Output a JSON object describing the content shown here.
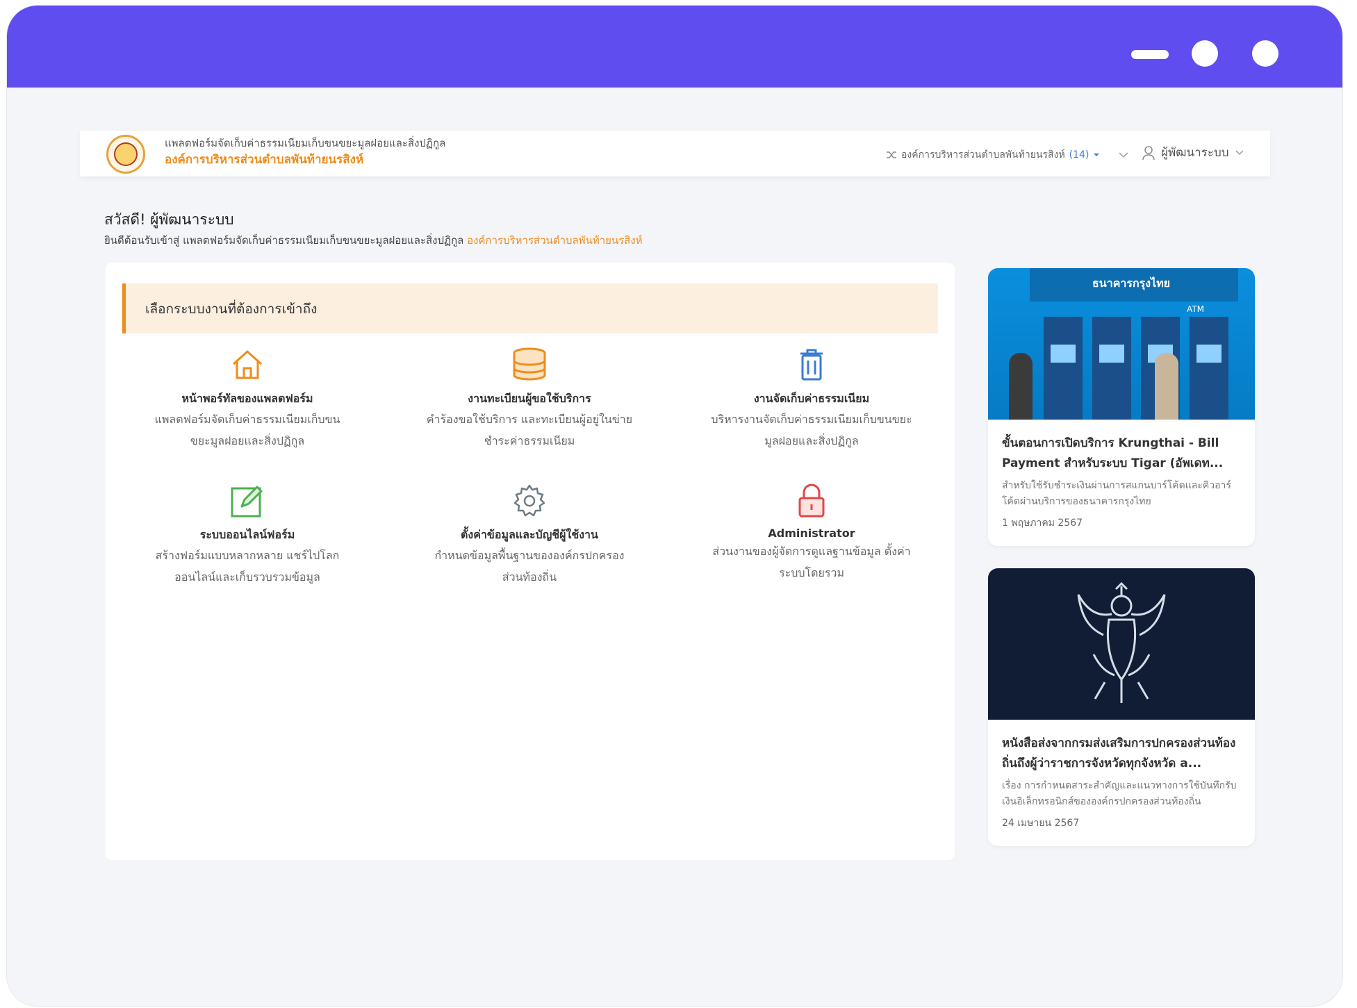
{
  "window": {
    "minimize_icon": "minimize-icon",
    "maximize_icon": "circle-icon",
    "close_icon": "circle-icon",
    "accent": "#5f4df0"
  },
  "header": {
    "brand_subtitle": "แพลตฟอร์มจัดเก็บค่าธรรมเนียมเก็บขนขยะมูลฝอยและสิ่งปฏิกูล",
    "brand_title": "องค์การบริหารส่วนตำบลพันท้ายนรสิงห์",
    "org_switch_label": "องค์การบริหารส่วนตำบลพันท้ายนรสิงห์",
    "org_switch_count": "(14)",
    "user_label": "ผู้พัฒนาระบบ"
  },
  "greeting": {
    "title": "สวัสดี! ผู้พัฒนาระบบ",
    "text": "ยินดีต้อนรับเข้าสู่ แพลตฟอร์มจัดเก็บค่าธรรมเนียมเก็บขนขยะมูลฝอยและสิ่งปฏิกูล",
    "org": "องค์การบริหารส่วนตำบลพันท้ายนรสิงห์"
  },
  "systems": {
    "heading": "เลือกระบบงานที่ต้องการเข้าถึง",
    "items": [
      {
        "icon": "home-icon",
        "title": "หน้าพอร์ทัลของแพลตฟอร์ม",
        "desc1": "แพลตฟอร์มจัดเก็บค่าธรรมเนียมเก็บขน",
        "desc2": "ขยะมูลฝอยและสิ่งปฏิกูล"
      },
      {
        "icon": "database-icon",
        "title": "งานทะเบียนผู้ขอใช้บริการ",
        "desc1": "คำร้องขอใช้บริการ และทะเบียนผู้อยู่ในข่าย",
        "desc2": "ชำระค่าธรรมเนียม"
      },
      {
        "icon": "trash-icon",
        "title": "งานจัดเก็บค่าธรรมเนียม",
        "desc1": "บริหารงานจัดเก็บค่าธรรมเนียมเก็บขนขยะ",
        "desc2": "มูลฝอยและสิ่งปฏิกูล"
      },
      {
        "icon": "edit-icon",
        "title": "ระบบออนไลน์ฟอร์ม",
        "desc1": "สร้างฟอร์มแบบหลากหลาย แชร์ไปโลก",
        "desc2": "ออนไลน์และเก็บรวบรวมข้อมูล"
      },
      {
        "icon": "gear-icon",
        "title": "ตั้งค่าข้อมูลและบัญชีผู้ใช้งาน",
        "desc1": "กำหนดข้อมูลพื้นฐานขององค์กรปกครอง",
        "desc2": "ส่วนท้องถิ่น"
      },
      {
        "icon": "lock-icon",
        "title": "Administrator",
        "desc1": "ส่วนงานของผู้จัดการดูแลฐานข้อมูล ตั้งค่า",
        "desc2": "ระบบโดยรวม"
      }
    ]
  },
  "news": [
    {
      "title": "ขั้นตอนการเปิดบริการ Krungthai - Bill Payment สำหรับระบบ Tigar (อัพเดท...",
      "excerpt": "สำหรับใช้รับชำระเงินผ่านการสแกนบาร์โค้ดและคิวอาร์โค้ดผ่านบริการของธนาคารกรุงไทย",
      "date": "1 พฤษภาคม 2567",
      "sign_text": "ธนาคารกรุงไทย",
      "atm_label": "ATM"
    },
    {
      "title": "หนังสือส่งจากกรมส่งเสริมการปกครองส่วนท้องถิ่นถึงผู้ว่าราชการจังหวัดทุกจังหวัด a...",
      "excerpt": "เรื่อง การกำหนดสาระสำคัญและแนวทางการใช้บันทึกรับเงินอิเล็กทรอนิกส์ขององค์กรปกครองส่วนท้องถิ่น",
      "date": "24 เมษายน 2567"
    }
  ],
  "colors": {
    "orange": "#f08c1a",
    "blue": "#3a7bd5",
    "green": "#4caf50",
    "red": "#e04848",
    "gray": "#6d7b86"
  }
}
